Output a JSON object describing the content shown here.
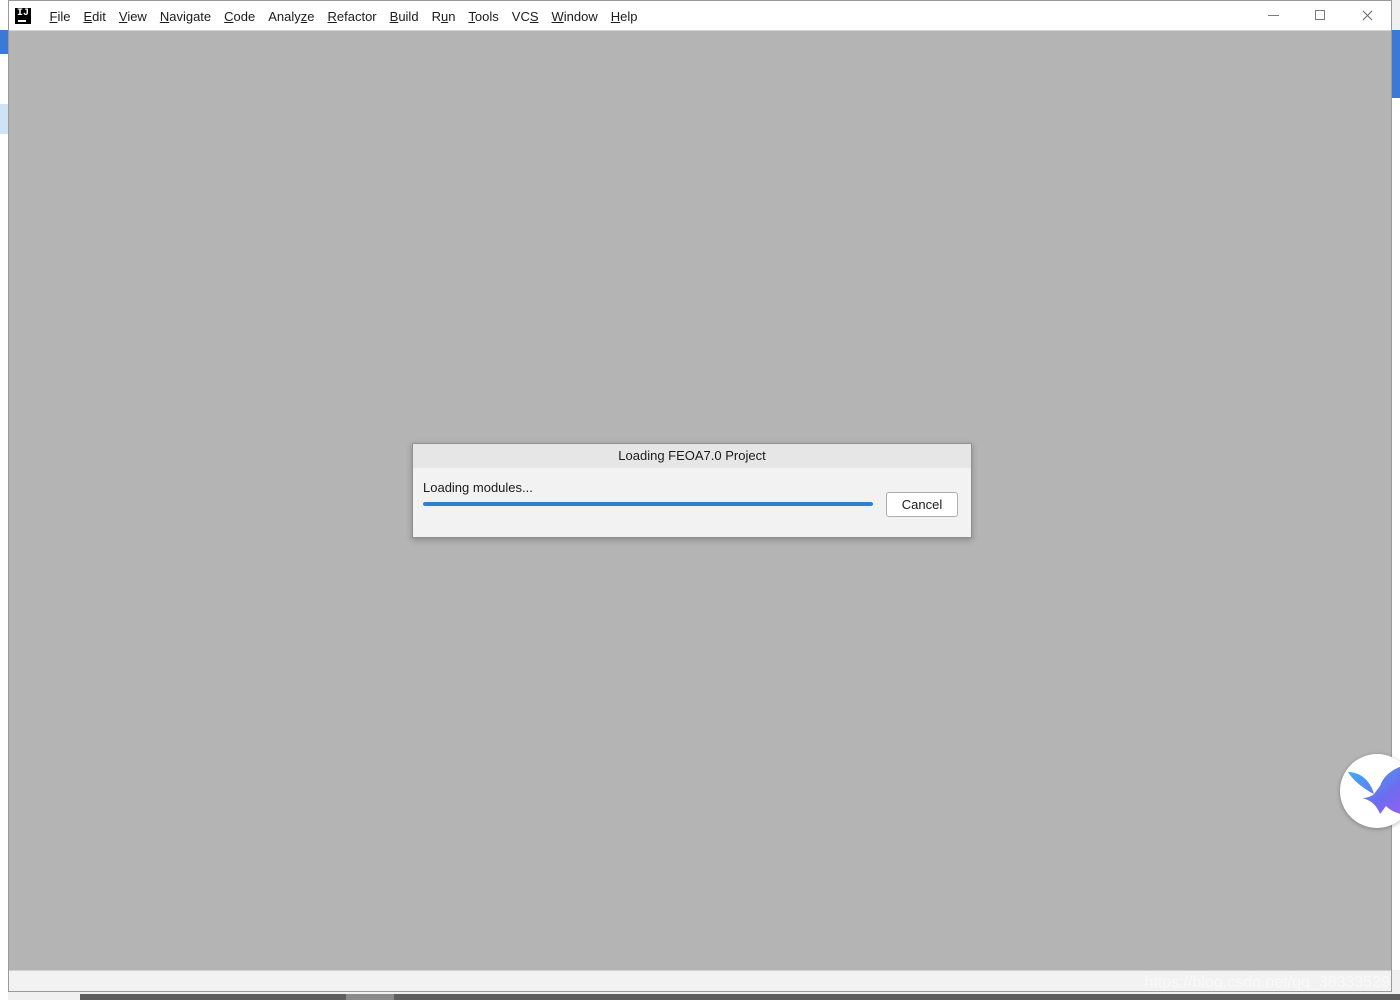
{
  "menu": {
    "items": [
      {
        "label": "File",
        "mnemonic": "F",
        "rest": "ile"
      },
      {
        "label": "Edit",
        "mnemonic": "E",
        "rest": "dit"
      },
      {
        "label": "View",
        "mnemonic": "V",
        "rest": "iew"
      },
      {
        "label": "Navigate",
        "mnemonic": "N",
        "rest": "avigate"
      },
      {
        "label": "Code",
        "mnemonic": "C",
        "rest": "ode"
      },
      {
        "label": "Analyze",
        "pre": "Analy",
        "mnemonic": "z",
        "rest": "e"
      },
      {
        "label": "Refactor",
        "mnemonic": "R",
        "rest": "efactor"
      },
      {
        "label": "Build",
        "mnemonic": "B",
        "rest": "uild"
      },
      {
        "label": "Run",
        "pre": "R",
        "mnemonic": "u",
        "rest": "n"
      },
      {
        "label": "Tools",
        "mnemonic": "T",
        "rest": "ools"
      },
      {
        "label": "VCS",
        "pre": "VC",
        "mnemonic": "S",
        "rest": ""
      },
      {
        "label": "Window",
        "mnemonic": "W",
        "rest": "indow"
      },
      {
        "label": "Help",
        "mnemonic": "H",
        "rest": "elp"
      }
    ]
  },
  "window_controls": {
    "icons": [
      "minimize-icon",
      "maximize-icon",
      "close-icon"
    ]
  },
  "dialog": {
    "title": "Loading FEOA7.0 Project",
    "status": "Loading modules...",
    "progress": 1.0,
    "cancel_label": "Cancel"
  },
  "watermark": "https://blog.csdn.net/qq_38333529",
  "colors": {
    "progress": "#2f80d1",
    "workspace": "#b4b4b4"
  }
}
